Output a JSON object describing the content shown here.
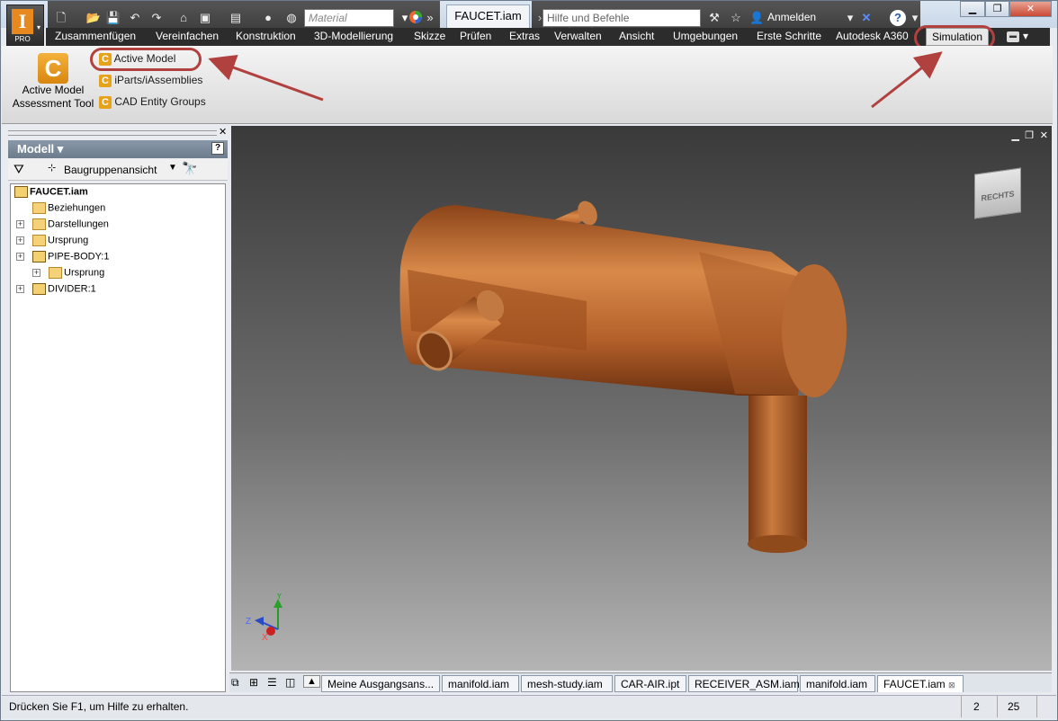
{
  "app": {
    "badge": "PRO"
  },
  "qat": {
    "material_placeholder": "Material"
  },
  "document_tab": "FAUCET.iam",
  "search": {
    "placeholder": "Hilfe und Befehle durchsuchen..",
    "signin": "Anmelden"
  },
  "menu": [
    "Zusammenfügen",
    "Vereinfachen",
    "Konstruktion",
    "3D-Modellierung",
    "Skizze",
    "Prüfen",
    "Extras",
    "Verwalten",
    "Ansicht",
    "Umgebungen",
    "Erste Schritte",
    "Autodesk A360",
    "Simulation"
  ],
  "ribbon": {
    "big_tool": {
      "line1": "Active Model",
      "line2": "Assessment Tool"
    },
    "small_tools": [
      "Active Model",
      "iParts/iAssemblies",
      "CAD Entity Groups"
    ]
  },
  "browser": {
    "title": "Modell ▾",
    "view_mode": "Baugruppenansicht",
    "tree": [
      {
        "label": "FAUCET.iam",
        "level": 0,
        "expander": false,
        "icon": "assembly"
      },
      {
        "label": "Beziehungen",
        "level": 1,
        "expander": false,
        "icon": "folder"
      },
      {
        "label": "Darstellungen",
        "level": 1,
        "expander": true,
        "icon": "representations"
      },
      {
        "label": "Ursprung",
        "level": 1,
        "expander": true,
        "icon": "folder"
      },
      {
        "label": "PIPE-BODY:1",
        "level": 1,
        "expander": true,
        "icon": "part"
      },
      {
        "label": "Ursprung",
        "level": 2,
        "expander": true,
        "icon": "folder"
      },
      {
        "label": "DIVIDER:1",
        "level": 1,
        "expander": true,
        "icon": "part"
      }
    ]
  },
  "viewcube": {
    "face": "RECHTS"
  },
  "triad": {
    "x": "X",
    "y": "Y",
    "z": "Z"
  },
  "doc_tabs": [
    "Meine Ausgangsans...",
    "manifold.iam",
    "mesh-study.iam",
    "CAR-AIR.ipt",
    "RECEIVER_ASM.iam",
    "manifold.iam",
    "FAUCET.iam"
  ],
  "status": {
    "text": "Drücken Sie F1, um Hilfe zu erhalten.",
    "n1": "2",
    "n2": "25"
  },
  "colors": {
    "copper": "#b8622a",
    "highlight": "#b0413e"
  }
}
